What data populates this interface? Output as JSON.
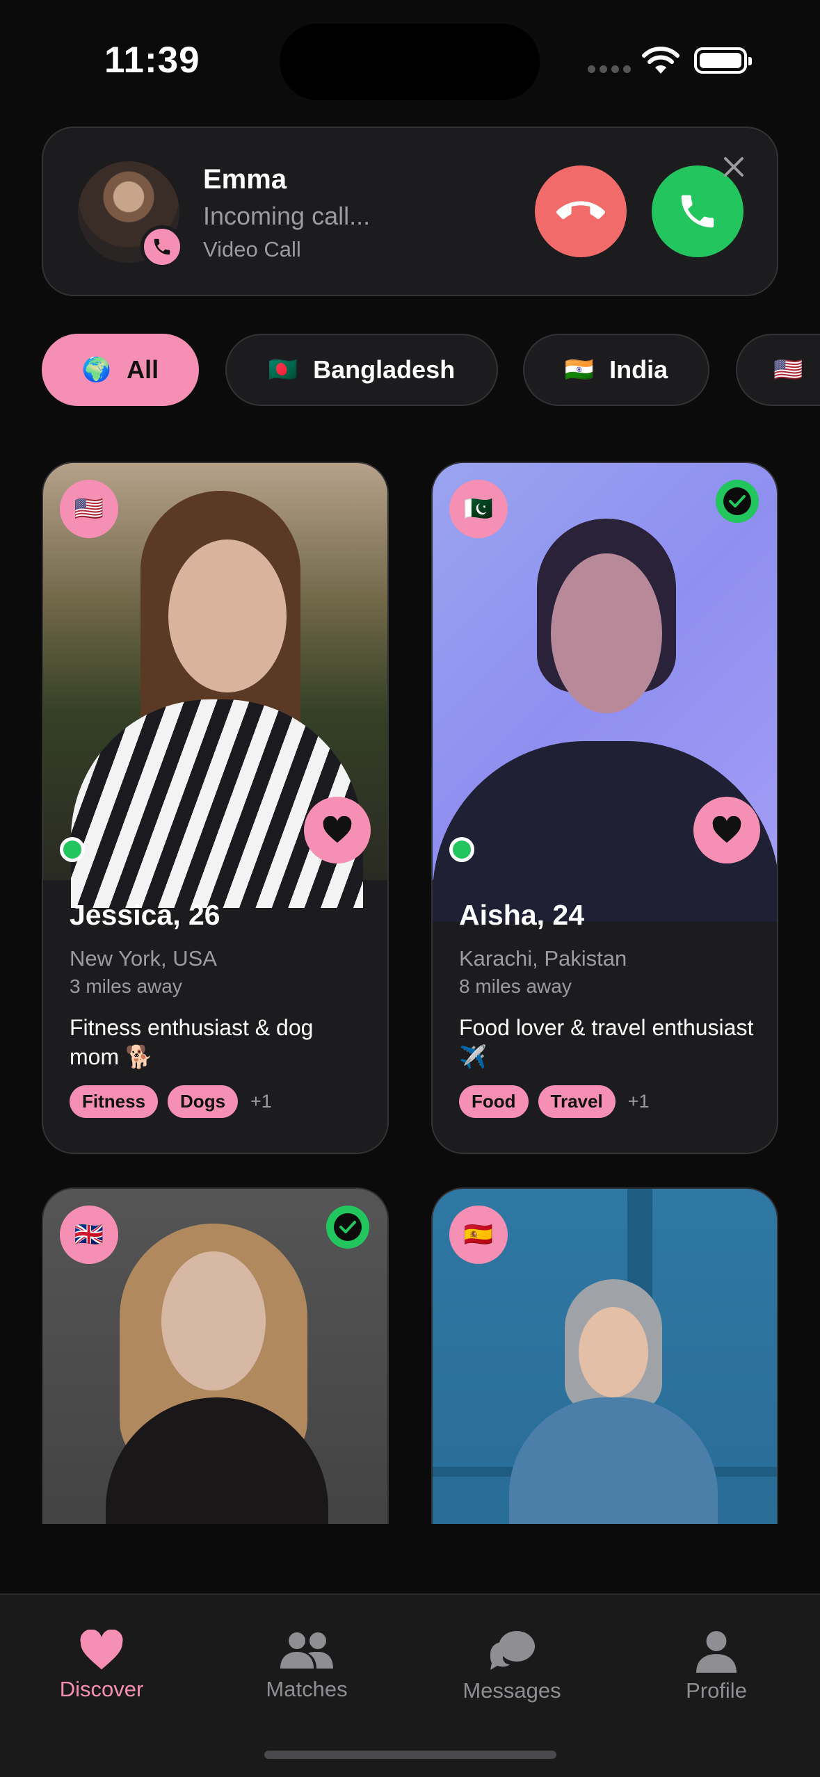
{
  "status_bar": {
    "time": "11:39"
  },
  "incoming_call": {
    "caller_name": "Emma",
    "status": "Incoming call...",
    "call_type": "Video Call"
  },
  "filters": [
    {
      "label": "All",
      "flag": "🌍",
      "active": true
    },
    {
      "label": "Bangladesh",
      "flag": "🇧🇩",
      "active": false
    },
    {
      "label": "India",
      "flag": "🇮🇳",
      "active": false
    },
    {
      "label": "",
      "flag": "🇺🇸",
      "active": false
    }
  ],
  "profiles": [
    {
      "name": "Jessica, 26",
      "location": "New York, USA",
      "distance": "3 miles away",
      "bio": "Fitness enthusiast & dog mom 🐕",
      "tags": [
        "Fitness",
        "Dogs"
      ],
      "more": "+1",
      "flag": "🇺🇸",
      "verified": false,
      "online": true
    },
    {
      "name": "Aisha, 24",
      "location": "Karachi, Pakistan",
      "distance": "8 miles away",
      "bio": "Food lover & travel enthusiast ✈️",
      "tags": [
        "Food",
        "Travel"
      ],
      "more": "+1",
      "flag": "🇵🇰",
      "verified": true,
      "online": true
    },
    {
      "flag": "🇬🇧",
      "verified": true
    },
    {
      "flag": "🇪🇸",
      "verified": false
    }
  ],
  "tabs": [
    {
      "label": "Discover",
      "icon": "heart-icon",
      "active": true
    },
    {
      "label": "Matches",
      "icon": "people-icon",
      "active": false
    },
    {
      "label": "Messages",
      "icon": "chat-bubbles-icon",
      "active": false
    },
    {
      "label": "Profile",
      "icon": "person-icon",
      "active": false
    }
  ],
  "colors": {
    "accent": "#f58fb3",
    "accept": "#22c55e",
    "decline": "#f26b6b",
    "background": "#0b0b0c",
    "card": "#1c1c1e"
  }
}
